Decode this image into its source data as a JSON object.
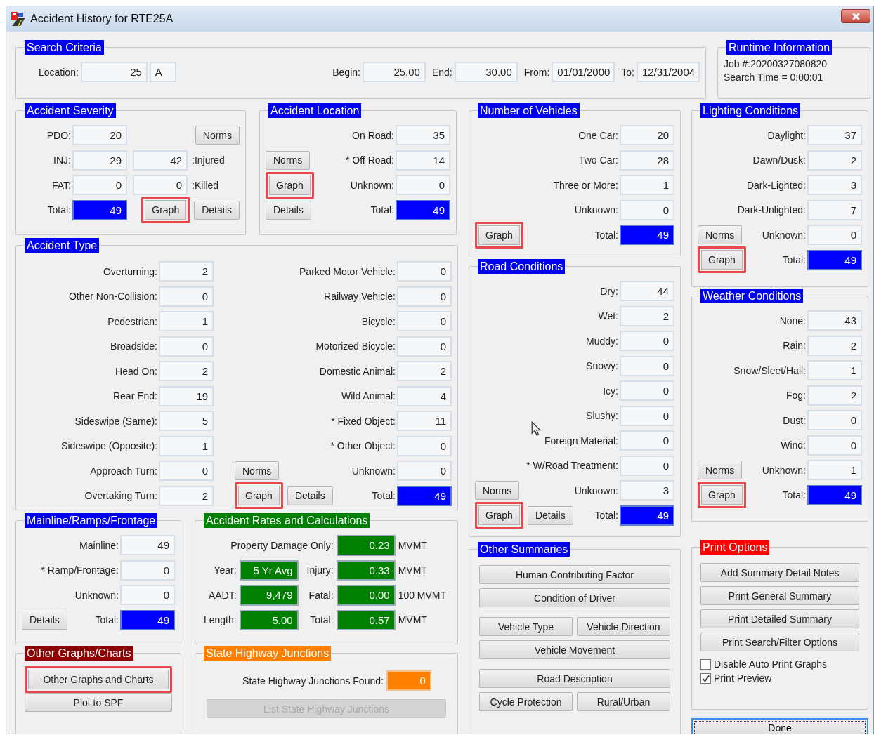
{
  "window": {
    "title": "Accident History for RTE25A"
  },
  "search_criteria": {
    "title": "Search Criteria",
    "location": {
      "label": "Location:",
      "value": "25",
      "suffix": "A"
    },
    "fields": [
      {
        "label": "Begin:",
        "value": "25.00"
      },
      {
        "label": "End:",
        "value": "30.00"
      },
      {
        "label": "From:",
        "value": "01/01/2000"
      },
      {
        "label": "To:",
        "value": "12/31/2004"
      }
    ]
  },
  "runtime_information": {
    "title": "Runtime Information",
    "lines": [
      "Job #:20200327080820",
      "Search Time = 0:00:01"
    ]
  },
  "accident_severity": {
    "title": "Accident Severity",
    "rows": [
      {
        "label": "PDO:",
        "value": "20",
        "kind": "count",
        "buttons": [
          {
            "label": "Norms",
            "highlighted": false
          }
        ]
      },
      {
        "label": "INJ:",
        "value": "29",
        "kind": "count",
        "extra": {
          "value": "42",
          "label": ":Injured"
        }
      },
      {
        "label": "FAT:",
        "value": "0",
        "kind": "count",
        "extra": {
          "value": "0",
          "label": ":Killed"
        }
      },
      {
        "label": "Total:",
        "value": "49",
        "kind": "total",
        "buttons": [
          {
            "label": "Graph",
            "highlighted": true
          },
          {
            "label": "Details",
            "highlighted": false
          }
        ]
      }
    ]
  },
  "accident_location": {
    "title": "Accident Location",
    "rows": [
      {
        "label": "On Road:",
        "value": "35",
        "kind": "count"
      },
      {
        "label": "* Off Road:",
        "value": "14",
        "kind": "count",
        "buttons": [
          {
            "label": "Norms",
            "highlighted": false
          }
        ]
      },
      {
        "label": "Unknown:",
        "value": "0",
        "kind": "count",
        "buttons": [
          {
            "label": "Graph",
            "highlighted": true
          }
        ]
      },
      {
        "label": "Total:",
        "value": "49",
        "kind": "total",
        "buttons": [
          {
            "label": "Details",
            "highlighted": false
          }
        ]
      }
    ]
  },
  "accident_type": {
    "title": "Accident Type",
    "columns": [
      {
        "rows": [
          {
            "label": "Overturning:",
            "value": "2",
            "kind": "count"
          },
          {
            "label": "Other Non-Collision:",
            "value": "0",
            "kind": "count"
          },
          {
            "label": "Pedestrian:",
            "value": "1",
            "kind": "count"
          },
          {
            "label": "Broadside:",
            "value": "0",
            "kind": "count"
          },
          {
            "label": "Head On:",
            "value": "2",
            "kind": "count"
          },
          {
            "label": "Rear End:",
            "value": "19",
            "kind": "count"
          },
          {
            "label": "Sideswipe (Same):",
            "value": "5",
            "kind": "count"
          },
          {
            "label": "Sideswipe (Opposite):",
            "value": "1",
            "kind": "count"
          },
          {
            "label": "Approach Turn:",
            "value": "0",
            "kind": "count"
          },
          {
            "label": "Overtaking Turn:",
            "value": "2",
            "kind": "count"
          }
        ]
      },
      {
        "rows": [
          {
            "label": "Parked Motor Vehicle:",
            "value": "0",
            "kind": "count"
          },
          {
            "label": "Railway Vehicle:",
            "value": "0",
            "kind": "count"
          },
          {
            "label": "Bicycle:",
            "value": "0",
            "kind": "count"
          },
          {
            "label": "Motorized Bicycle:",
            "value": "0",
            "kind": "count"
          },
          {
            "label": "Domestic Animal:",
            "value": "2",
            "kind": "count"
          },
          {
            "label": "Wild Animal:",
            "value": "4",
            "kind": "count"
          },
          {
            "label": "* Fixed Object:",
            "value": "11",
            "kind": "count"
          },
          {
            "label": "* Other Object:",
            "value": "0",
            "kind": "count"
          },
          {
            "label": "Unknown:",
            "value": "0",
            "kind": "count",
            "buttons": [
              {
                "label": "Norms",
                "highlighted": false
              }
            ]
          },
          {
            "label": "Total:",
            "value": "49",
            "kind": "total",
            "buttons": [
              {
                "label": "Graph",
                "highlighted": true
              },
              {
                "label": "Details",
                "highlighted": false
              }
            ]
          }
        ]
      }
    ]
  },
  "mainline_ramps_frontage": {
    "title": "Mainline/Ramps/Frontage",
    "rows": [
      {
        "label": "Mainline:",
        "value": "49",
        "kind": "count"
      },
      {
        "label": "* Ramp/Frontage:",
        "value": "0",
        "kind": "count"
      },
      {
        "label": "Unknown:",
        "value": "0",
        "kind": "count"
      },
      {
        "label": "Total:",
        "value": "49",
        "kind": "total",
        "buttons": [
          {
            "label": "Details",
            "highlighted": false
          }
        ]
      }
    ]
  },
  "accident_rates": {
    "title": "Accident Rates and Calculations",
    "rows": [
      {
        "right": {
          "label": "Property Damage Only:",
          "value": "0.23",
          "unit": "MVMT"
        }
      },
      {
        "left": {
          "label": "Year:",
          "value": "5 Yr Avg"
        },
        "right": {
          "label": "Injury:",
          "value": "0.33",
          "unit": "MVMT"
        }
      },
      {
        "left": {
          "label": "AADT:",
          "value": "9,479"
        },
        "right": {
          "label": "Fatal:",
          "value": "0.00",
          "unit": "100 MVMT"
        }
      },
      {
        "left": {
          "label": "Length:",
          "value": "5.00"
        },
        "right": {
          "label": "Total:",
          "value": "0.57",
          "unit": "MVMT"
        }
      }
    ]
  },
  "other_graphs": {
    "title": "Other Graphs/Charts",
    "buttons": [
      {
        "label": "Other Graphs and Charts",
        "highlighted": true
      },
      {
        "label": "Plot to SPF",
        "highlighted": false
      }
    ]
  },
  "state_highway_junctions": {
    "title": "State Highway Junctions",
    "label": "State Highway Junctions Found:",
    "value": "0",
    "button": {
      "label": "List State Highway Junctions",
      "disabled": true
    }
  },
  "number_of_vehicles": {
    "title": "Number of Vehicles",
    "rows": [
      {
        "label": "One Car:",
        "value": "20",
        "kind": "count"
      },
      {
        "label": "Two Car:",
        "value": "28",
        "kind": "count"
      },
      {
        "label": "Three or More:",
        "value": "1",
        "kind": "count"
      },
      {
        "label": "Unknown:",
        "value": "0",
        "kind": "count"
      },
      {
        "label": "Total:",
        "value": "49",
        "kind": "total",
        "buttons": [
          {
            "label": "Graph",
            "highlighted": true
          }
        ]
      }
    ]
  },
  "road_conditions": {
    "title": "Road Conditions",
    "rows": [
      {
        "label": "Dry:",
        "value": "44",
        "kind": "count"
      },
      {
        "label": "Wet:",
        "value": "2",
        "kind": "count"
      },
      {
        "label": "Muddy:",
        "value": "0",
        "kind": "count"
      },
      {
        "label": "Snowy:",
        "value": "0",
        "kind": "count"
      },
      {
        "label": "Icy:",
        "value": "0",
        "kind": "count"
      },
      {
        "label": "Slushy:",
        "value": "0",
        "kind": "count"
      },
      {
        "label": "Foreign Material:",
        "value": "0",
        "kind": "count"
      },
      {
        "label": "* W/Road Treatment:",
        "value": "0",
        "kind": "count"
      },
      {
        "label": "Unknown:",
        "value": "3",
        "kind": "count",
        "buttons": [
          {
            "label": "Norms",
            "highlighted": false
          }
        ]
      },
      {
        "label": "Total:",
        "value": "49",
        "kind": "total",
        "buttons": [
          {
            "label": "Graph",
            "highlighted": true
          },
          {
            "label": "Details",
            "highlighted": false
          }
        ]
      }
    ]
  },
  "other_summaries": {
    "title": "Other Summaries",
    "button_groups": [
      [
        [
          "Human Contributing Factor"
        ],
        [
          "Condition of Driver"
        ]
      ],
      [
        [
          "Vehicle Type",
          "Vehicle Direction"
        ],
        [
          "Vehicle Movement"
        ]
      ],
      [
        [
          "Road Description"
        ],
        [
          "Cycle Protection",
          "Rural/Urban"
        ]
      ]
    ]
  },
  "lighting_conditions": {
    "title": "Lighting Conditions",
    "rows": [
      {
        "label": "Daylight:",
        "value": "37",
        "kind": "count"
      },
      {
        "label": "Dawn/Dusk:",
        "value": "2",
        "kind": "count"
      },
      {
        "label": "Dark-Lighted:",
        "value": "3",
        "kind": "count"
      },
      {
        "label": "Dark-Unlighted:",
        "value": "7",
        "kind": "count"
      },
      {
        "label": "Unknown:",
        "value": "0",
        "kind": "count",
        "buttons": [
          {
            "label": "Norms",
            "highlighted": false
          }
        ]
      },
      {
        "label": "Total:",
        "value": "49",
        "kind": "total",
        "buttons": [
          {
            "label": "Graph",
            "highlighted": true
          }
        ]
      }
    ]
  },
  "weather_conditions": {
    "title": "Weather Conditions",
    "rows": [
      {
        "label": "None:",
        "value": "43",
        "kind": "count"
      },
      {
        "label": "Rain:",
        "value": "2",
        "kind": "count"
      },
      {
        "label": "Snow/Sleet/Hail:",
        "value": "1",
        "kind": "count"
      },
      {
        "label": "Fog:",
        "value": "2",
        "kind": "count"
      },
      {
        "label": "Dust:",
        "value": "0",
        "kind": "count"
      },
      {
        "label": "Wind:",
        "value": "0",
        "kind": "count"
      },
      {
        "label": "Unknown:",
        "value": "1",
        "kind": "count",
        "buttons": [
          {
            "label": "Norms",
            "highlighted": false
          }
        ]
      },
      {
        "label": "Total:",
        "value": "49",
        "kind": "total",
        "buttons": [
          {
            "label": "Graph",
            "highlighted": true
          }
        ]
      }
    ]
  },
  "print_options": {
    "title": "Print Options",
    "buttons": [
      "Add Summary Detail Notes",
      "Print General Summary",
      "Print Detailed Summary",
      "Print Search/Filter Options"
    ],
    "checkboxes": [
      {
        "label": "Disable Auto Print Graphs",
        "checked": false
      },
      {
        "label": "Print Preview",
        "checked": true
      }
    ]
  },
  "done_button": "Done"
}
